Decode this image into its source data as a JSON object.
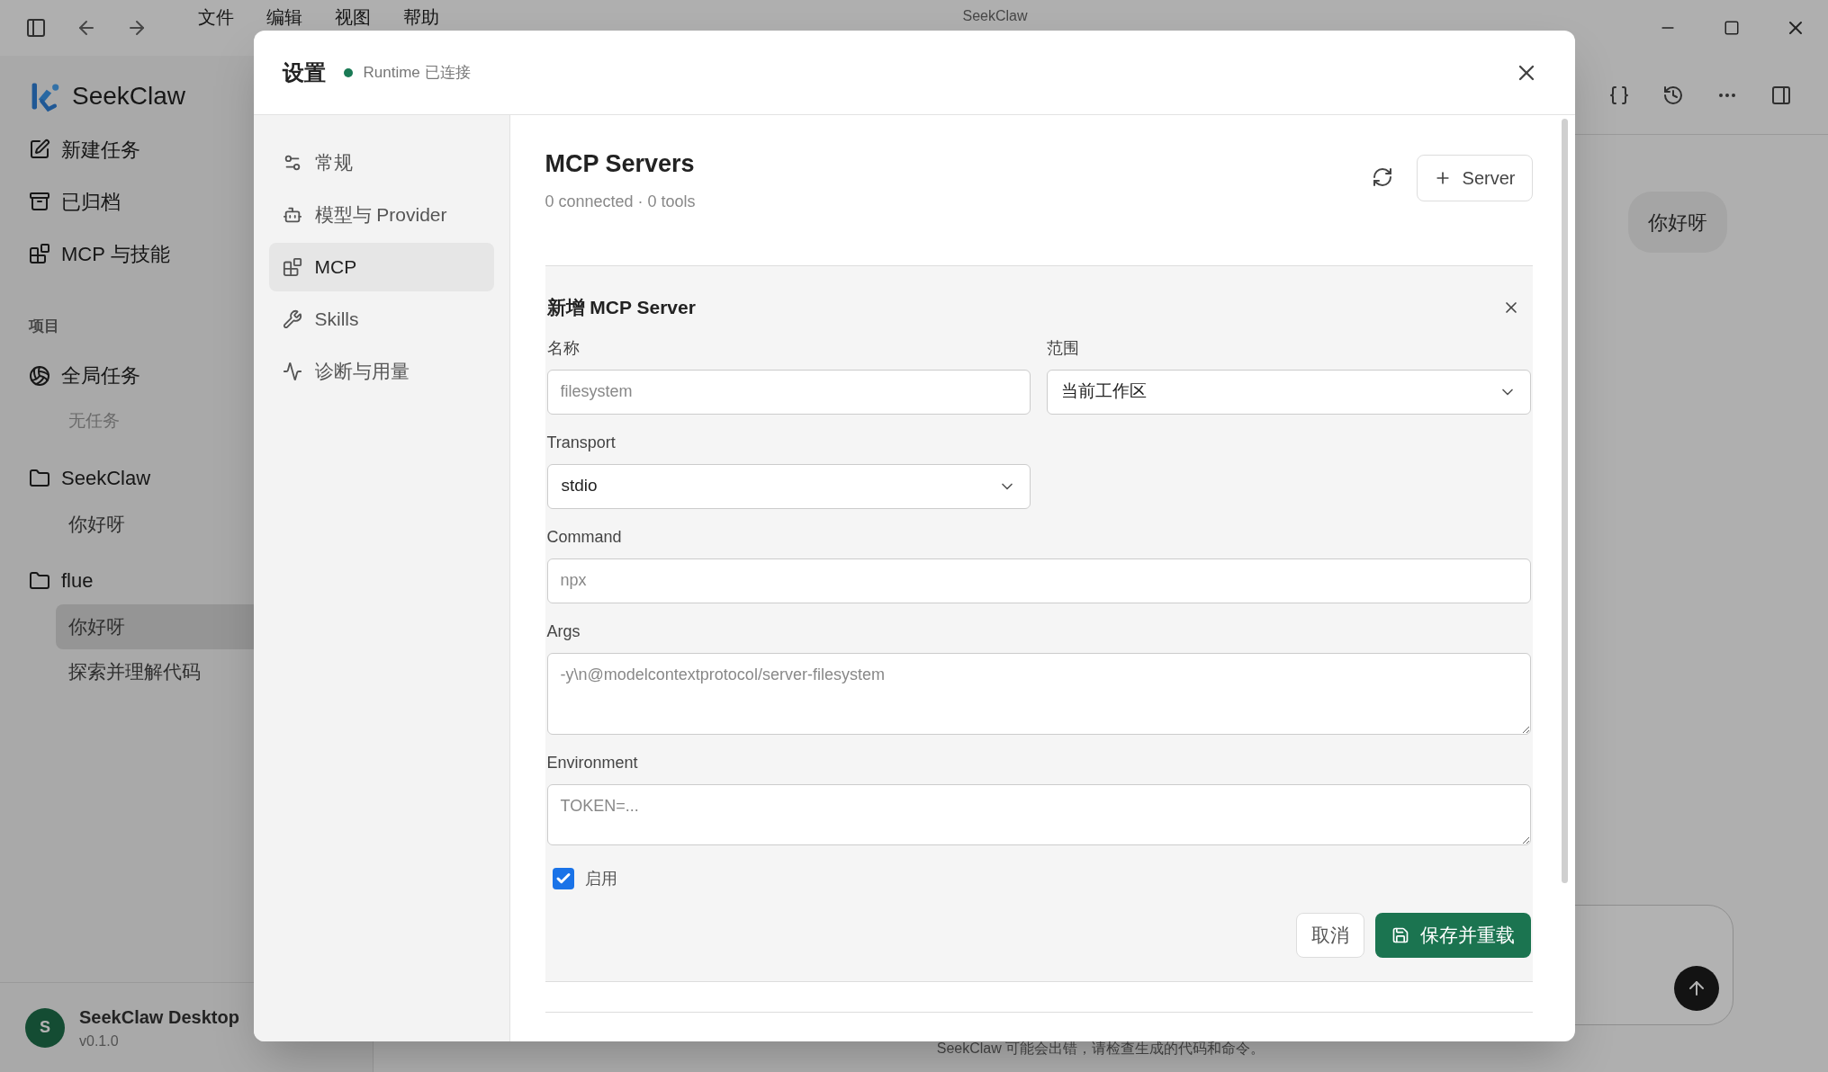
{
  "window": {
    "title": "SeekClaw",
    "menu": [
      "文件",
      "编辑",
      "视图",
      "帮助"
    ]
  },
  "sidebar": {
    "brand": "SeekClaw",
    "nav": [
      {
        "label": "新建任务",
        "kind": "edit"
      },
      {
        "label": "已归档",
        "kind": "archive"
      },
      {
        "label": "MCP 与技能",
        "kind": "blocks"
      }
    ],
    "projects_heading": "项目",
    "projects": [
      {
        "name": "全局任务",
        "kind": "globe",
        "tasks": [
          {
            "label": "无任务",
            "kind": "empty",
            "selected": false
          }
        ]
      },
      {
        "name": "SeekClaw",
        "kind": "folder",
        "tasks": [
          {
            "label": "你好呀",
            "kind": "task",
            "selected": false
          }
        ]
      },
      {
        "name": "flue",
        "kind": "folder",
        "tasks": [
          {
            "label": "你好呀",
            "kind": "task",
            "selected": true
          },
          {
            "label": "探索并理解代码",
            "kind": "task",
            "selected": false
          }
        ]
      }
    ],
    "footer": {
      "avatar": "S",
      "name": "SeekClaw Desktop",
      "version": "v0.1.0"
    }
  },
  "chat": {
    "message": "你好呀",
    "disclaimer": "SeekClaw 可能会出错，请检查生成的代码和命令。"
  },
  "settings": {
    "title": "设置",
    "status": {
      "text": "Runtime 已连接",
      "connected": true
    },
    "nav": [
      {
        "label": "常规",
        "kind": "general",
        "selected": false
      },
      {
        "label": "模型与 Provider",
        "kind": "model",
        "selected": false
      },
      {
        "label": "MCP",
        "kind": "mcp",
        "selected": true
      },
      {
        "label": "Skills",
        "kind": "skills",
        "selected": false
      },
      {
        "label": "诊断与用量",
        "kind": "diagnostics",
        "selected": false
      }
    ],
    "section": {
      "title": "MCP Servers",
      "subtitle": "0 connected · 0 tools",
      "add_button": "Server"
    },
    "form": {
      "title": "新增 MCP Server",
      "fields": [
        {
          "label": "名称",
          "kind": "input",
          "placeholder": "filesystem"
        },
        {
          "label": "范围",
          "kind": "select",
          "value": "当前工作区"
        },
        {
          "label": "Transport",
          "kind": "select",
          "value": "stdio"
        },
        {
          "label": "Command",
          "kind": "input",
          "placeholder": "npx"
        },
        {
          "label": "Args",
          "kind": "textarea",
          "placeholder": "-y\\n@modelcontextprotocol/server-filesystem"
        },
        {
          "label": "Environment",
          "kind": "textarea",
          "placeholder": "TOKEN=..."
        }
      ],
      "enabled": {
        "label": "启用",
        "checked": true
      },
      "cancel": "取消",
      "save": "保存并重载"
    }
  }
}
